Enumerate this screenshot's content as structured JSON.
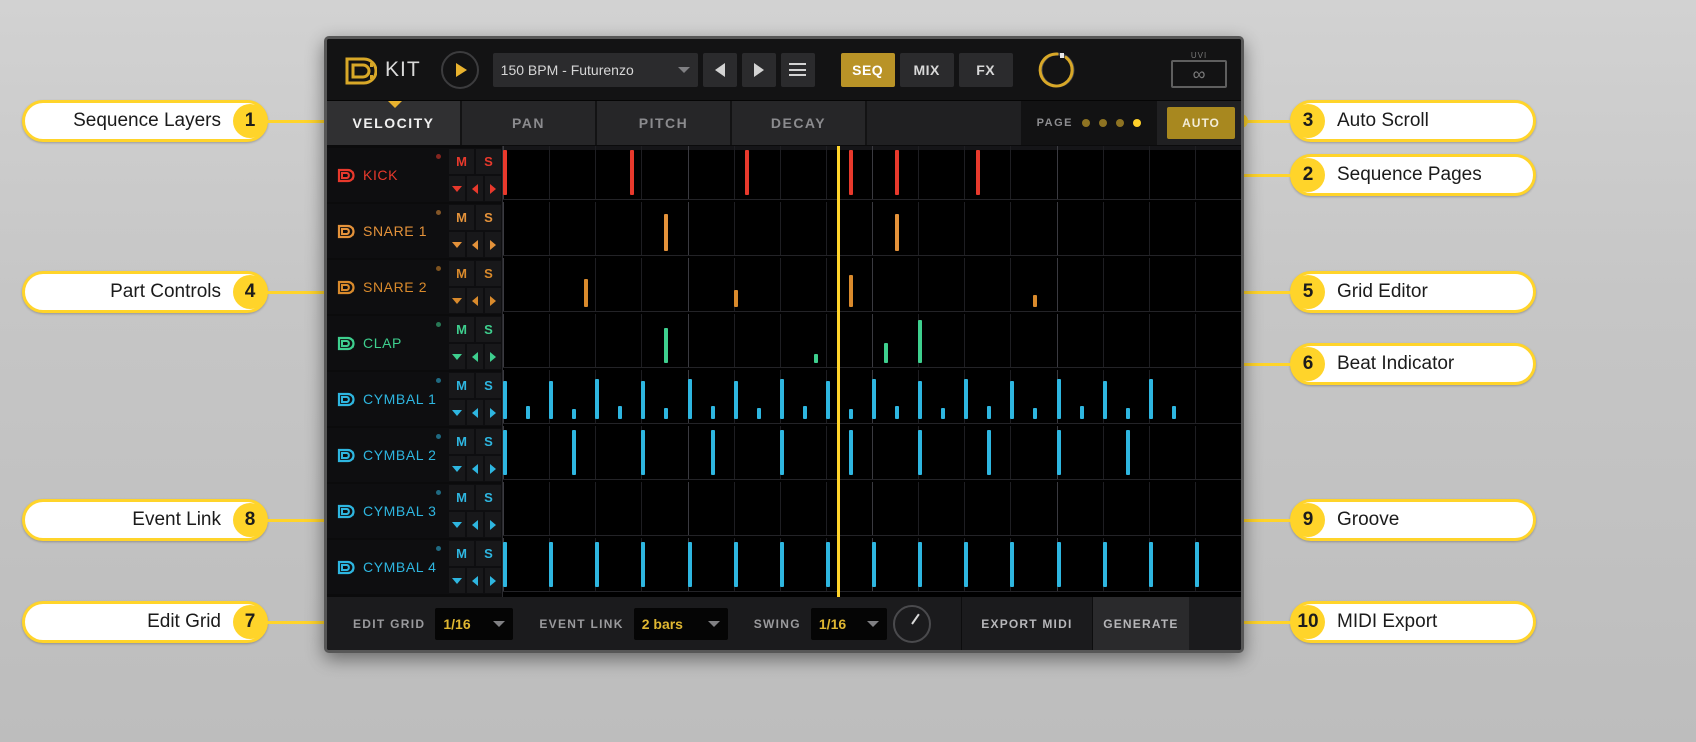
{
  "app": {
    "title": "KIT",
    "preset": "150 BPM - Futurenzo",
    "uvi_wordmark": "UVI"
  },
  "header": {
    "play_label": "play",
    "prev_label": "prev",
    "next_label": "next",
    "menu_label": "menu",
    "modes": [
      {
        "label": "SEQ",
        "active": true
      },
      {
        "label": "MIX",
        "active": false
      },
      {
        "label": "FX",
        "active": false
      }
    ],
    "master_knob_value": 78
  },
  "layer_tabs": [
    {
      "label": "VELOCITY",
      "active": true
    },
    {
      "label": "PAN",
      "active": false
    },
    {
      "label": "PITCH",
      "active": false
    },
    {
      "label": "DECAY",
      "active": false
    }
  ],
  "pages": {
    "label": "PAGE",
    "dots": [
      {
        "active": false
      },
      {
        "active": false
      },
      {
        "active": false
      },
      {
        "active": true
      }
    ]
  },
  "auto_scroll": {
    "label": "AUTO",
    "active": true
  },
  "part_controls": {
    "mute_label": "M",
    "solo_label": "S",
    "dropdown_label": "menu",
    "prev_label": "prev",
    "next_label": "next"
  },
  "parts": [
    {
      "name": "KICK",
      "color": "#e8392c"
    },
    {
      "name": "SNARE 1",
      "color": "#e4923a"
    },
    {
      "name": "SNARE 2",
      "color": "#d98a2c"
    },
    {
      "name": "CLAP",
      "color": "#3ecf8e"
    },
    {
      "name": "CYMBAL 1",
      "color": "#2eb6e0"
    },
    {
      "name": "CYMBAL 2",
      "color": "#2eb6e0"
    },
    {
      "name": "CYMBAL 3",
      "color": "#2eb6e0"
    },
    {
      "name": "CYMBAL 4",
      "color": "#2eb6e0"
    }
  ],
  "transport": {
    "edit_grid": {
      "label": "EDIT GRID",
      "value": "1/16"
    },
    "event_link": {
      "label": "EVENT LINK",
      "value": "2 bars"
    },
    "swing": {
      "label": "SWING",
      "value": "1/16"
    },
    "export_midi": {
      "label": "EXPORT MIDI"
    },
    "generate": {
      "label": "GENERATE"
    }
  },
  "annotations": [
    {
      "num": "1",
      "label": "Sequence Layers",
      "side": "left"
    },
    {
      "num": "2",
      "label": "Sequence Pages",
      "side": "right"
    },
    {
      "num": "3",
      "label": "Auto Scroll",
      "side": "right"
    },
    {
      "num": "4",
      "label": "Part Controls",
      "side": "left"
    },
    {
      "num": "5",
      "label": "Grid Editor",
      "side": "right"
    },
    {
      "num": "6",
      "label": "Beat Indicator",
      "side": "right"
    },
    {
      "num": "7",
      "label": "Edit Grid",
      "side": "left"
    },
    {
      "num": "8",
      "label": "Event Link",
      "side": "left"
    },
    {
      "num": "9",
      "label": "Groove",
      "side": "right"
    },
    {
      "num": "10",
      "label": "MIDI Export",
      "side": "right"
    }
  ],
  "colors": {
    "accent": "#ffd42a",
    "gold": "#b99327",
    "panel": "#1b1b1d",
    "grid_bg": "#000000"
  },
  "sequence": {
    "steps_per_row": 64,
    "beat_indicator_step": 29,
    "rows": [
      {
        "part": "KICK",
        "notes": [
          [
            0,
            1.0
          ],
          [
            11,
            1.0
          ],
          [
            21,
            1.0
          ],
          [
            30,
            1.0
          ],
          [
            34,
            1.0
          ],
          [
            41,
            1.0
          ]
        ]
      },
      {
        "part": "SNARE 1",
        "notes": [
          [
            14,
            0.82
          ],
          [
            34,
            0.82
          ]
        ]
      },
      {
        "part": "SNARE 2",
        "notes": [
          [
            7,
            0.62
          ],
          [
            20,
            0.38
          ],
          [
            30,
            0.72
          ],
          [
            46,
            0.26
          ]
        ]
      },
      {
        "part": "CLAP",
        "notes": [
          [
            14,
            0.78
          ],
          [
            27,
            0.2
          ],
          [
            33,
            0.45
          ],
          [
            36,
            0.95
          ]
        ]
      },
      {
        "part": "CYMBAL 1",
        "notes": [
          [
            0,
            0.85
          ],
          [
            2,
            0.3
          ],
          [
            4,
            0.85
          ],
          [
            6,
            0.22
          ],
          [
            8,
            0.9
          ],
          [
            10,
            0.3
          ],
          [
            12,
            0.85
          ],
          [
            14,
            0.25
          ],
          [
            16,
            0.9
          ],
          [
            18,
            0.3
          ],
          [
            20,
            0.85
          ],
          [
            22,
            0.25
          ],
          [
            24,
            0.9
          ],
          [
            26,
            0.3
          ],
          [
            28,
            0.85
          ],
          [
            30,
            0.22
          ],
          [
            32,
            0.9
          ],
          [
            34,
            0.3
          ],
          [
            36,
            0.85
          ],
          [
            38,
            0.25
          ],
          [
            40,
            0.9
          ],
          [
            42,
            0.3
          ],
          [
            44,
            0.85
          ],
          [
            46,
            0.25
          ],
          [
            48,
            0.9
          ],
          [
            50,
            0.3
          ],
          [
            52,
            0.85
          ],
          [
            54,
            0.25
          ],
          [
            56,
            0.9
          ],
          [
            58,
            0.3
          ]
        ]
      },
      {
        "part": "CYMBAL 2",
        "notes": [
          [
            0,
            1.0
          ],
          [
            6,
            1.0
          ],
          [
            12,
            1.0
          ],
          [
            18,
            1.0
          ],
          [
            24,
            1.0
          ],
          [
            30,
            1.0
          ],
          [
            36,
            1.0
          ],
          [
            42,
            1.0
          ],
          [
            48,
            1.0
          ],
          [
            54,
            1.0
          ]
        ]
      },
      {
        "part": "CYMBAL 3",
        "notes": []
      },
      {
        "part": "CYMBAL 4",
        "notes": [
          [
            0,
            1.0
          ],
          [
            4,
            1.0
          ],
          [
            8,
            1.0
          ],
          [
            12,
            1.0
          ],
          [
            16,
            1.0
          ],
          [
            20,
            1.0
          ],
          [
            24,
            1.0
          ],
          [
            28,
            1.0
          ],
          [
            32,
            1.0
          ],
          [
            36,
            1.0
          ],
          [
            40,
            1.0
          ],
          [
            44,
            1.0
          ],
          [
            48,
            1.0
          ],
          [
            52,
            1.0
          ],
          [
            56,
            1.0
          ],
          [
            60,
            1.0
          ]
        ]
      }
    ]
  }
}
